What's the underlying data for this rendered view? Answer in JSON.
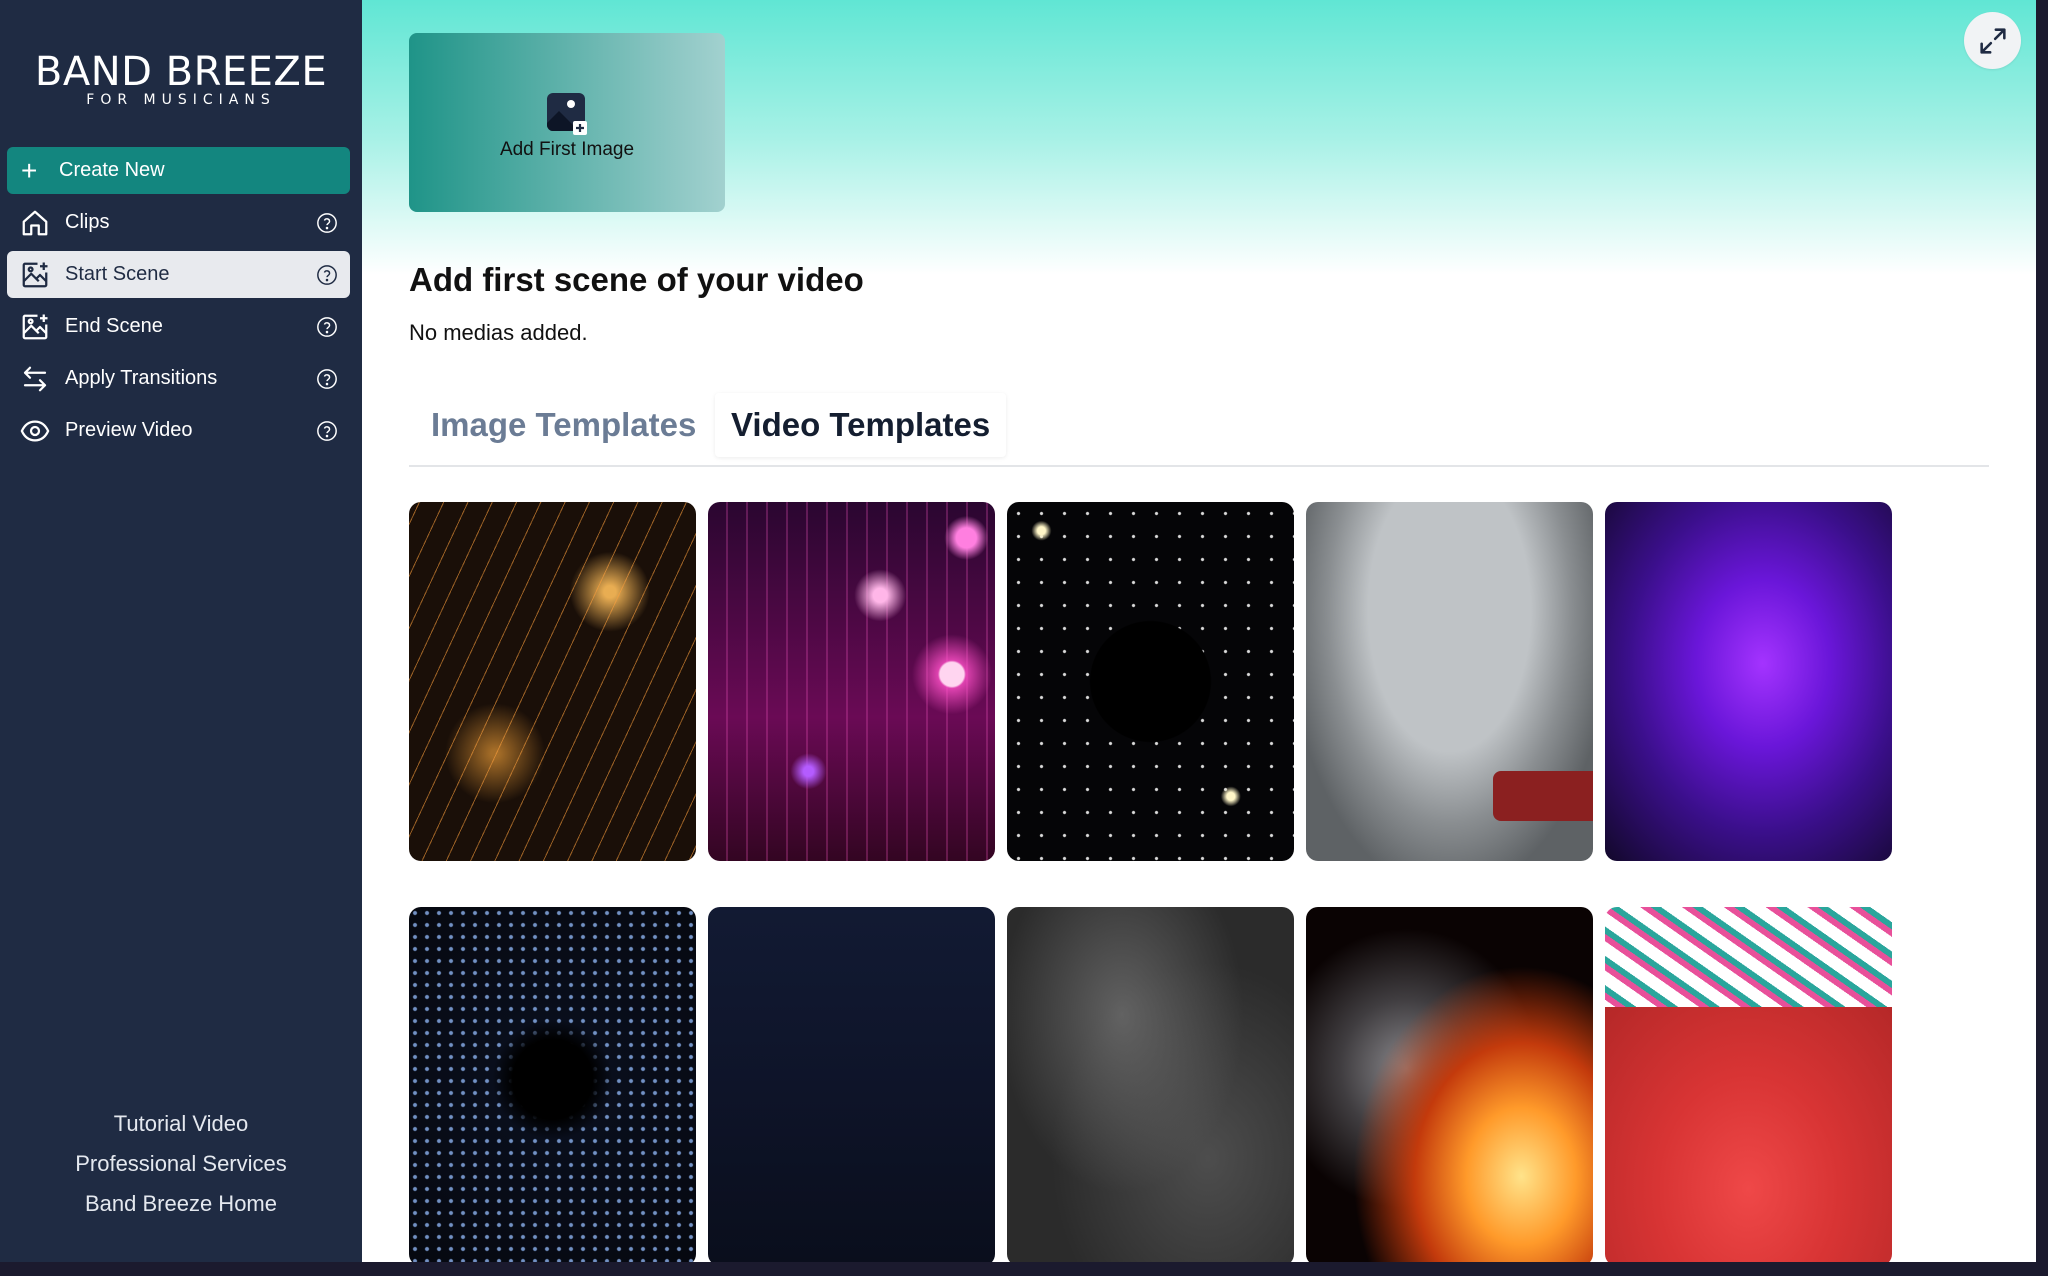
{
  "brand": {
    "title": "BAND BREEZE",
    "subtitle": "FOR MUSICIANS"
  },
  "sidebar": {
    "create_label": "Create New",
    "items": [
      {
        "label": "Clips",
        "icon": "home-icon"
      },
      {
        "label": "Start Scene",
        "icon": "image-add-icon",
        "active": true
      },
      {
        "label": "End Scene",
        "icon": "image-add-icon"
      },
      {
        "label": "Apply Transitions",
        "icon": "arrows-swap-icon"
      },
      {
        "label": "Preview Video",
        "icon": "eye-icon"
      }
    ],
    "footer_links": [
      "Tutorial Video",
      "Professional Services",
      "Band Breeze Home"
    ]
  },
  "main": {
    "upload_label": "Add First Image",
    "section_title": "Add first scene of your video",
    "section_subtitle": "No medias added.",
    "tabs": [
      {
        "label": "Image Templates",
        "selected": false
      },
      {
        "label": "Video Templates",
        "selected": true
      }
    ],
    "templates": [
      {
        "name": "sparks",
        "row": 1
      },
      {
        "name": "pink-bokeh",
        "row": 1
      },
      {
        "name": "starfield",
        "row": 1
      },
      {
        "name": "vinyl-record",
        "row": 1
      },
      {
        "name": "purple-smoke",
        "row": 1
      },
      {
        "name": "particle-tunnel",
        "row": 2
      },
      {
        "name": "navy-gradient",
        "row": 2
      },
      {
        "name": "grey-smoke",
        "row": 2
      },
      {
        "name": "fire-smoke",
        "row": 2
      },
      {
        "name": "graffiti-wall",
        "row": 2
      }
    ]
  },
  "colors": {
    "sidebar_bg": "#1f2b43",
    "accent": "#13867f",
    "active_item_bg": "#e8eaee",
    "tab_inactive": "#6b7c95",
    "hero_gradient_top": "#60e6d4"
  }
}
